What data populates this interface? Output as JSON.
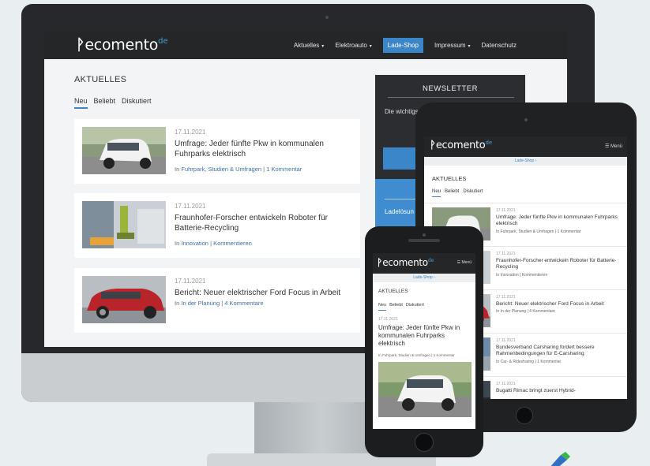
{
  "brand": {
    "icon": "ᚹ",
    "word": "ecomento",
    "tld": "de"
  },
  "colors": {
    "accent": "#3a86c8",
    "nav_bg": "#242628",
    "page_bg": "#f2f4f5",
    "sidebar_dark": "#2b2d30",
    "sidebar_blue": "#3f8cd0"
  },
  "desktop": {
    "nav": {
      "aktuelles": "Aktuelles",
      "elektroauto": "Elektroauto",
      "lade_shop": "Lade-Shop",
      "impressum": "Impressum",
      "datenschutz": "Datenschutz",
      "caret": "▾"
    },
    "section_title": "AKTUELLES",
    "tabs": [
      "Neu",
      "Beliebt",
      "Diskutiert"
    ],
    "articles": [
      {
        "date": "17.11.2021",
        "title": "Umfrage: Jeder fünfte Pkw in kommunalen Fuhrparks elektrisch",
        "in": "In",
        "category": "Fuhrpark, Studien & Umfragen",
        "sep": "|",
        "comments": "1 Kommentar"
      },
      {
        "date": "17.11.2021",
        "title": "Fraunhofer-Forscher entwickeln Roboter für Batterie-Recycling",
        "in": "In",
        "category": "Innovation",
        "sep": "|",
        "comments": "Kommentieren"
      },
      {
        "date": "17.11.2021",
        "title": "Bericht: Neuer elektrischer Ford Focus in Arbeit",
        "in": "In",
        "category": "In der Planung",
        "sep": "|",
        "comments": "4 Kommentare"
      }
    ],
    "newsletter": {
      "title": "NEWSLETTER",
      "text": "Die wichtigs"
    },
    "ad": {
      "text": "Ladelösun"
    }
  },
  "tablet": {
    "menu": "☰ Menü",
    "shop": "Lade-Shop ›",
    "section_title": "AKTUELLES",
    "tabs": [
      "Neu",
      "Beliebt",
      "Diskutiert"
    ],
    "articles": [
      {
        "date": "17.11.2021",
        "title": "Umfrage: Jeder fünfte Pkw in kommunalen Fuhrparks elektrisch",
        "meta": "In Fuhrpark, Studien & Umfragen | 1 Kommentar"
      },
      {
        "date": "17.11.2021",
        "title": "Fraunhofer-Forscher entwickeln Roboter für Batterie-Recycling",
        "meta": "In Innovation | Kommentieren"
      },
      {
        "date": "17.11.2021",
        "title": "Bericht: Neuer elektrischer Ford Focus in Arbeit",
        "meta": "In In der Planung | 4 Kommentare"
      },
      {
        "date": "17.11.2021",
        "title": "Bundesverband Carsharing fordert bessere Rahmenbedingungen für E-Carsharing",
        "meta": "In Car- & Ridesharing | 1 Kommentar"
      },
      {
        "date": "17.11.2021",
        "title": "Bugatti Rimac bringt zuerst Hybrid-",
        "meta": ""
      }
    ]
  },
  "phone": {
    "menu": "☰ Menü",
    "shop": "Lade-Shop ›",
    "section_title": "AKTUELLES",
    "tabs": [
      "Neu",
      "Beliebt",
      "Diskutiert"
    ],
    "article": {
      "date": "17.11.2021",
      "title": "Umfrage: Jeder fünfte Pkw in kommunalen Fuhrparks elektrisch",
      "meta": "In Fuhrpark, Studien & Umfragen | 1 Kommentar"
    }
  }
}
